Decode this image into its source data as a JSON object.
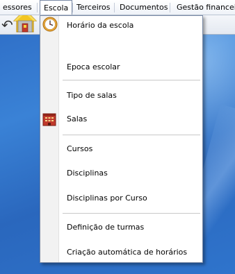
{
  "menubar": {
    "items": [
      {
        "label": "essores"
      },
      {
        "label": "Escola"
      },
      {
        "label": "Terceiros"
      },
      {
        "label": "Documentos"
      },
      {
        "label": "Gestão financeira"
      }
    ],
    "active_index": 1
  },
  "toolbar": {
    "icons": [
      "back-arrow-icon",
      "home-icon"
    ]
  },
  "dropdown": {
    "items": [
      {
        "label": "Horário da escola",
        "icon": "clock-icon"
      },
      {
        "label": "Epoca escolar"
      },
      {
        "label": "Tipo de salas"
      },
      {
        "label": "Salas",
        "icon": "building-icon"
      },
      {
        "label": "Cursos"
      },
      {
        "label": "Disciplinas"
      },
      {
        "label": "Disciplinas por Curso"
      },
      {
        "label": "Definição de turmas"
      },
      {
        "label": "Criação automática de horários"
      }
    ]
  },
  "colors": {
    "desktop_blue": "#2f6fc7",
    "menu_border": "#7a8aa6",
    "gutter": "#f2f2f2"
  }
}
